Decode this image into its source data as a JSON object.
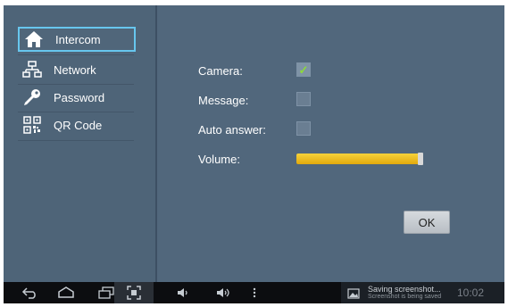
{
  "sidebar": {
    "items": [
      {
        "label": "Intercom",
        "icon": "home-icon",
        "active": true
      },
      {
        "label": "Network",
        "icon": "network-icon",
        "active": false
      },
      {
        "label": "Password",
        "icon": "key-icon",
        "active": false
      },
      {
        "label": "QR Code",
        "icon": "qr-code-icon",
        "active": false
      }
    ]
  },
  "settings": {
    "camera": {
      "label": "Camera:",
      "checked": true
    },
    "message": {
      "label": "Message:",
      "checked": false
    },
    "auto_answer": {
      "label": "Auto answer:",
      "checked": false
    },
    "volume": {
      "label": "Volume:",
      "level": 1.0
    }
  },
  "ok_label": "OK",
  "navbar": {
    "icons": [
      "back-icon",
      "home-icon",
      "recent-apps-icon",
      "screenshot-icon",
      "volume-down-icon",
      "volume-up-icon",
      "menu-icon"
    ],
    "notification": {
      "title": "Saving screenshot...",
      "subtitle": "Screenshot is being saved",
      "time": "10:02"
    }
  },
  "colors": {
    "background": "#51677c",
    "active_border": "#67c6ee",
    "volume_fill": "#f0c22a",
    "check": "#8ddb3a"
  }
}
